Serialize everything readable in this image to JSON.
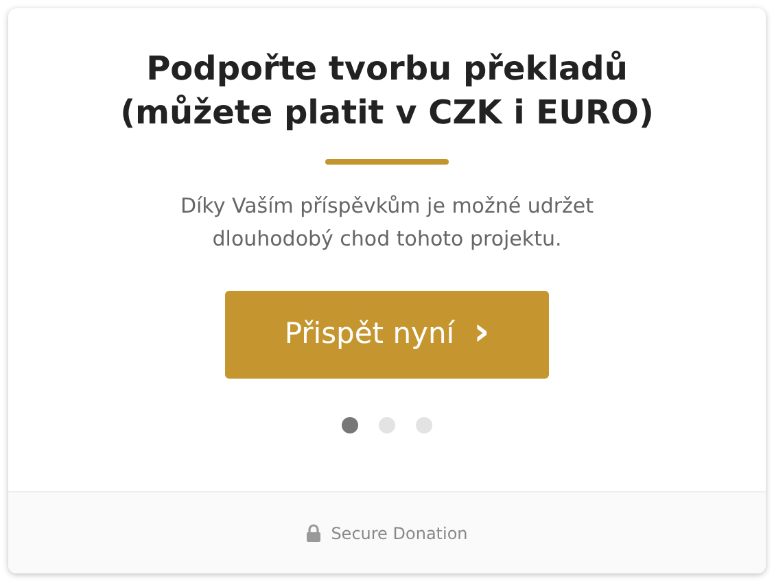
{
  "title": "Podpořte tvorbu překladů (můžete platit v CZK i EURO)",
  "description": "Díky Vaším příspěvkům je možné udržet dlouhodobý chod tohoto projektu.",
  "button": {
    "label": "Přispět nyní",
    "icon": "›"
  },
  "steps": [
    {
      "selected": true
    },
    {
      "selected": false
    },
    {
      "selected": false
    }
  ],
  "footer": {
    "label": "Secure Donation"
  }
}
